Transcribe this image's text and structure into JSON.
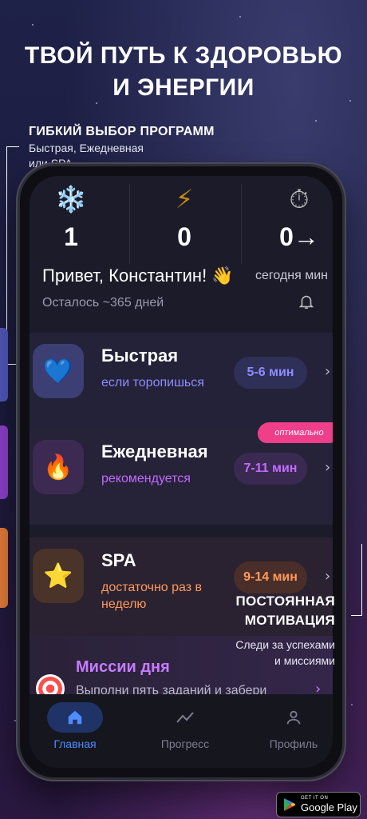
{
  "headline": {
    "line1": "ТВОЙ ПУТЬ К ЗДОРОВЬЮ",
    "line2": "И ЭНЕРГИИ"
  },
  "annotation_left": {
    "title": "ГИБКИЙ ВЫБОР ПРОГРАММ",
    "line1": "Быстрая, Ежедневная",
    "line2": "или SPA"
  },
  "stats": [
    {
      "icon": "snowflake-icon",
      "glyph": "❄️",
      "value": "1"
    },
    {
      "icon": "lightning-icon",
      "glyph": "⚡",
      "value": "0"
    },
    {
      "icon": "stopwatch-icon",
      "glyph": "⏱",
      "value": "0→"
    }
  ],
  "greeting": "Привет, Константин! 👋",
  "today_label": "сегодня мин",
  "remaining": "Осталось ~365 дней",
  "programs": [
    {
      "glyph": "💙",
      "title": "Быстрая",
      "subtitle": "если торопишься",
      "duration": "5-6 мин",
      "accent": "#8f8cff",
      "sub_color": "#8f8cff"
    },
    {
      "glyph": "🔥",
      "title": "Ежедневная",
      "subtitle": "рекомендуется",
      "duration": "7-11 мин",
      "accent": "#c46bff",
      "sub_color": "#c46bff",
      "badge": "оптимально"
    },
    {
      "glyph": "⭐",
      "title": "SPA",
      "subtitle": "достаточно раз в неделю",
      "duration": "9-14 мин",
      "accent": "#ff9a5c",
      "sub_color": "#ff9a5c"
    }
  ],
  "missions": {
    "title": "Миссии дня",
    "subtitle": "Выполни пять заданий и забери"
  },
  "tabs": [
    {
      "label": "Главная",
      "icon": "home-icon"
    },
    {
      "label": "Прогресс",
      "icon": "chart-icon"
    },
    {
      "label": "Профиль",
      "icon": "profile-icon"
    }
  ],
  "annotation_right": {
    "title1": "ПОСТОЯННАЯ",
    "title2": "МОТИВАЦИЯ",
    "line1": "Следи за успехами",
    "line2": "и миссиями"
  },
  "store_badge": {
    "top": "GET IT ON",
    "name": "Google Play"
  }
}
